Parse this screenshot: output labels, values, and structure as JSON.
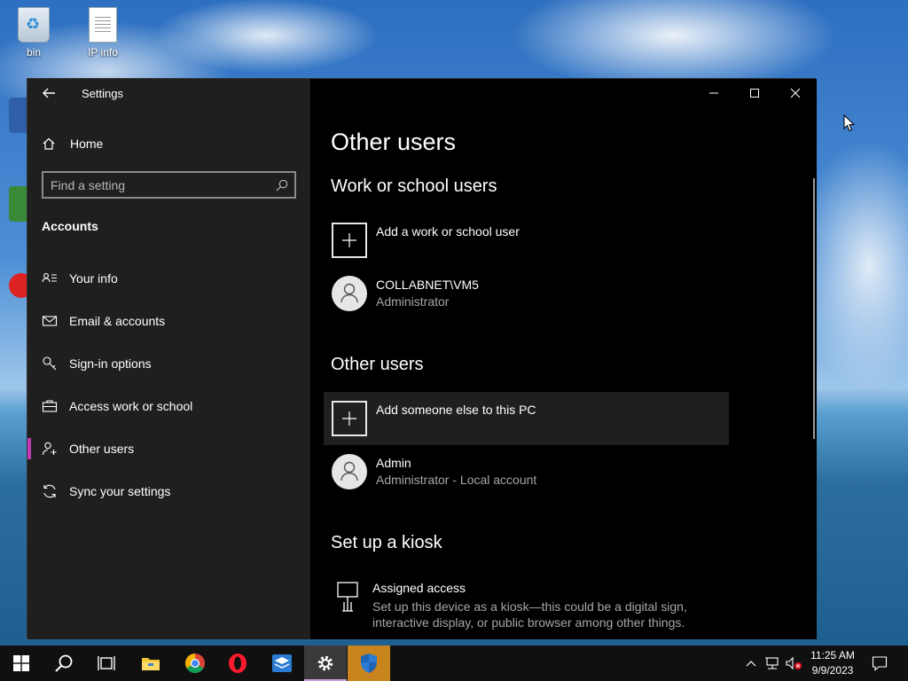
{
  "desktop": {
    "icons": [
      {
        "label": "bin"
      },
      {
        "label": "IP info"
      }
    ]
  },
  "window": {
    "title": "Settings",
    "controls": {
      "minimize": "—",
      "maximize": "☐",
      "close": "✕"
    }
  },
  "sidebar": {
    "home_label": "Home",
    "search_placeholder": "Find a setting",
    "section_label": "Accounts",
    "items": [
      {
        "label": "Your info",
        "icon": "person-card-icon"
      },
      {
        "label": "Email & accounts",
        "icon": "mail-icon"
      },
      {
        "label": "Sign-in options",
        "icon": "key-icon"
      },
      {
        "label": "Access work or school",
        "icon": "briefcase-icon"
      },
      {
        "label": "Other users",
        "icon": "add-person-icon",
        "active": true
      },
      {
        "label": "Sync your settings",
        "icon": "sync-icon"
      }
    ]
  },
  "content": {
    "page_title": "Other users",
    "work_school": {
      "heading": "Work or school users",
      "add_label": "Add a work or school user",
      "users": [
        {
          "name": "COLLABNET\\VM5",
          "role": "Administrator"
        }
      ]
    },
    "other_users": {
      "heading": "Other users",
      "add_label": "Add someone else to this PC",
      "users": [
        {
          "name": "Admin",
          "role": "Administrator - Local account"
        }
      ]
    },
    "kiosk": {
      "heading": "Set up a kiosk",
      "title": "Assigned access",
      "description": "Set up this device as a kiosk—this could be a digital sign, interactive display, or public browser among other things."
    }
  },
  "taskbar": {
    "clock_time": "11:25 AM",
    "clock_date": "9/9/2023",
    "accent_active": "#c9a0dc",
    "highlight_color": "#c8841d"
  }
}
